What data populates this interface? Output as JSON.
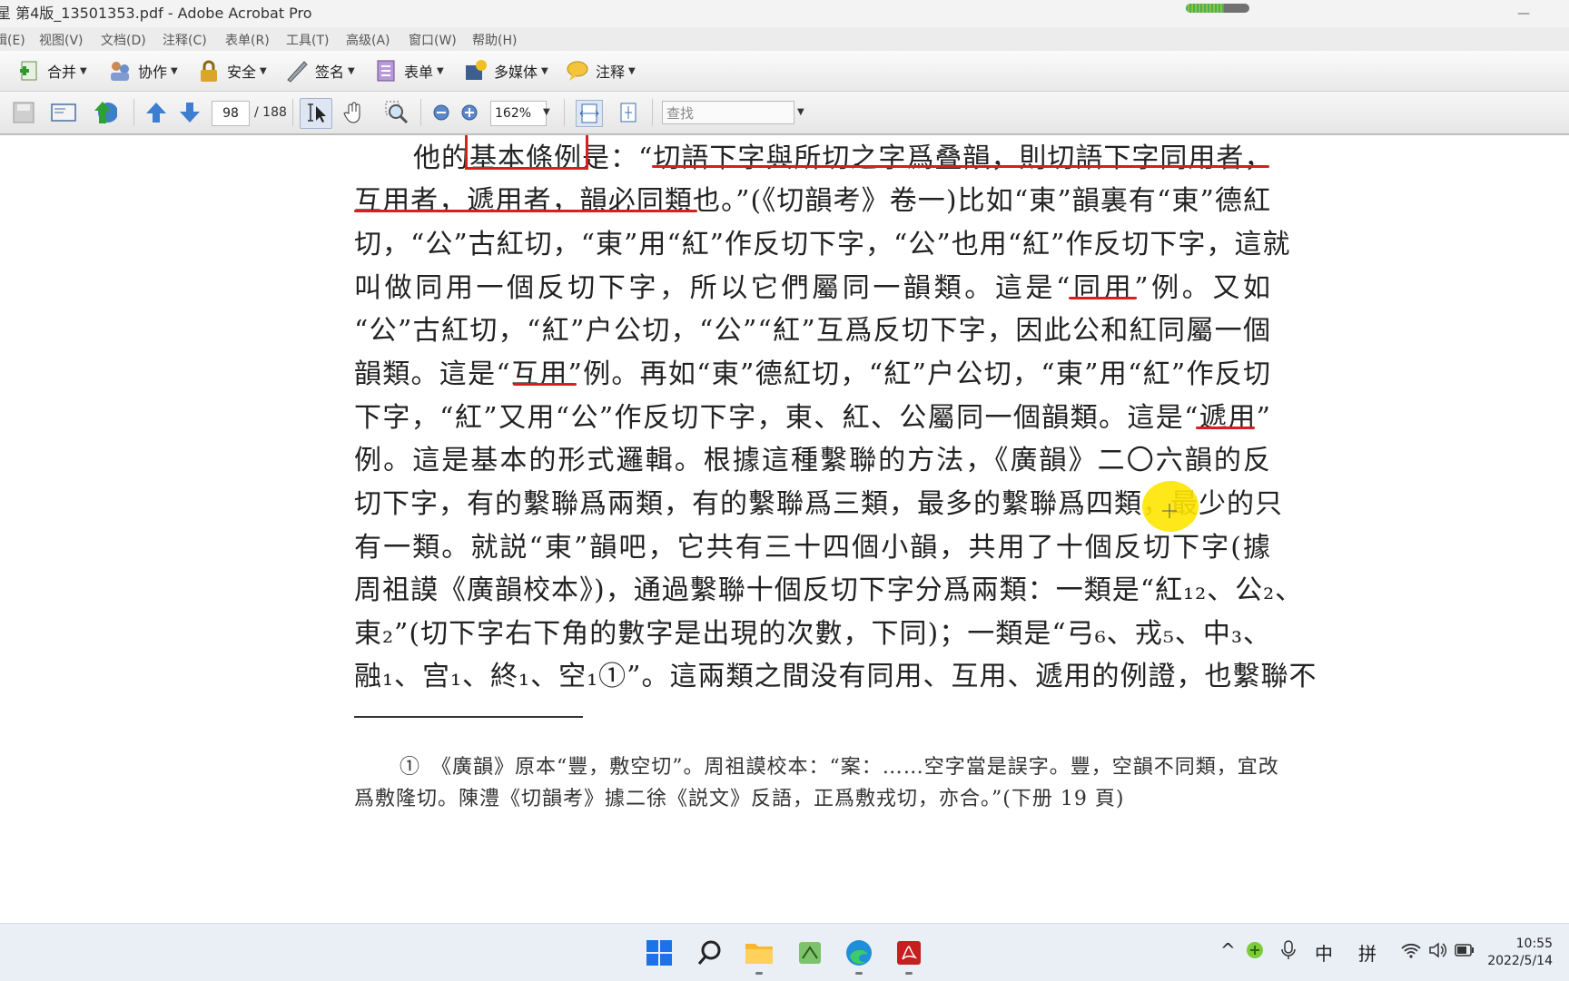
{
  "window": {
    "title": "星 第4版_13501353.pdf - Adobe Acrobat Pro",
    "progress": 0.6
  },
  "menu": [
    "辑(E)",
    "视图(V)",
    "文档(D)",
    "注释(C)",
    "表单(R)",
    "工具(T)",
    "高级(A)",
    "窗口(W)",
    "帮助(H)"
  ],
  "toolbar1": [
    {
      "label": "合并",
      "icon": "combine-icon"
    },
    {
      "label": "协作",
      "icon": "collaborate-icon"
    },
    {
      "label": "安全",
      "icon": "lock-icon"
    },
    {
      "label": "签名",
      "icon": "pen-icon"
    },
    {
      "label": "表单",
      "icon": "form-icon"
    },
    {
      "label": "多媒体",
      "icon": "multimedia-icon"
    },
    {
      "label": "注释",
      "icon": "comment-icon"
    }
  ],
  "toolbar2": {
    "page_current": "98",
    "page_total": "/ 188",
    "zoom": "162%",
    "search_placeholder": "查找"
  },
  "document": {
    "lines": [
      "他的基本條例是：“切語下字與所切之字爲叠韻，則切語下字同用者，",
      "互用者，遞用者，韻必同類也。”(《切韻考》卷一)比如“東”韻裏有“東”德紅",
      "切，“公”古紅切，“東”用“紅”作反切下字，“公”也用“紅”作反切下字，這就",
      "叫做同用一個反切下字，所以它們屬同一韻類。這是“同用”例。又如",
      "“公”古紅切，“紅”户公切，“公”“紅”互爲反切下字，因此公和紅同屬一個",
      "韻類。這是“互用”例。再如“東”德紅切，“紅”户公切，“東”用“紅”作反切",
      "下字，“紅”又用“公”作反切下字，東、紅、公屬同一個韻類。這是“遞用”",
      "例。這是基本的形式邏輯。根據這種繫聯的方法，《廣韻》二〇六韻的反",
      "切下字，有的繫聯爲兩類，有的繫聯爲三類，最多的繫聯爲四類，最少的只",
      "有一類。就説“東”韻吧，它共有三十四個小韻，共用了十個反切下字(據",
      "周祖謨《廣韻校本》)，通過繫聯十個反切下字分爲兩類：一類是“紅₁₂、公₂、",
      "東₂”(切下字右下角的數字是出現的次數，下同)；一類是“弓₆、戎₅、中₃、",
      "融₁、宫₁、終₁、空₁①”。這兩類之間没有同用、互用、遞用的例證，也繫聯不"
    ],
    "footnote": [
      "①　《廣韻》原本“豐，敷空切”。周祖謨校本：“案：……空字當是誤字。豐，空韻不同類，宜改",
      "爲敷隆切。陳澧《切韻考》據二徐《説文》反語，正爲敷戎切，亦合。”(下册 19 頁)"
    ]
  },
  "taskbar": {
    "apps": [
      "windows-start-icon",
      "search-icon",
      "file-explorer-icon",
      "app-icon",
      "edge-browser-icon",
      "acrobat-icon"
    ],
    "tray": {
      "chevron": "^",
      "ime_mode": "中",
      "ime_name": "拼"
    },
    "time": "10:55",
    "date": "2022/5/14"
  },
  "colors": {
    "annotation_red": "#d81e1e",
    "highlight_yellow": "#ffe600"
  }
}
